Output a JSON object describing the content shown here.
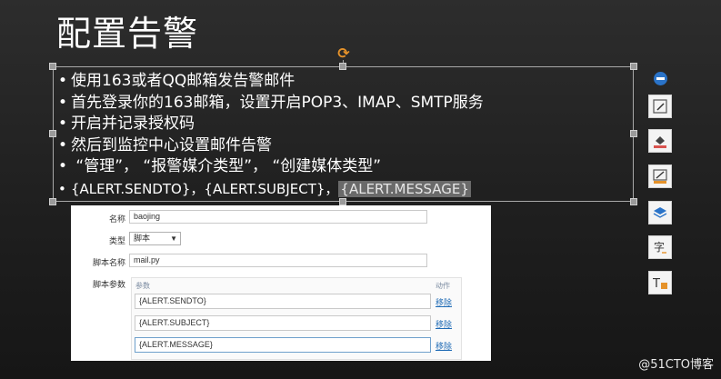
{
  "slide": {
    "title": "配置告警",
    "bullets": [
      "使用163或者QQ邮箱发告警邮件",
      "首先登录你的163邮箱，设置开启POP3、IMAP、SMTP服务",
      "开启并记录授权码",
      "然后到监控中心设置邮件告警",
      " “管理”， “报警媒介类型”， “创建媒体类型”"
    ],
    "last_bullet": {
      "part1": "{ALERT.SENDTO}，{ALERT.SUBJECT}，",
      "highlighted": "{ALERT.MESSAGE}"
    }
  },
  "form": {
    "name_label": "名称",
    "name_value": "baojing",
    "type_label": "类型",
    "type_value": "脚本",
    "script_label": "脚本名称",
    "script_value": "mail.py",
    "params_label": "脚本参数",
    "col_param": "参数",
    "col_action": "动作",
    "params": [
      {
        "value": "{ALERT.SENDTO}",
        "action": "移除"
      },
      {
        "value": "{ALERT.SUBJECT}",
        "action": "移除"
      },
      {
        "value": "{ALERT.MESSAGE}",
        "action": "移除"
      }
    ]
  },
  "toolbar": {
    "icons": [
      "collapse-icon",
      "edit-shape-icon",
      "fill-color-icon",
      "line-color-icon",
      "layers-icon",
      "text-options-icon",
      "text-resize-icon"
    ],
    "accent": "#2a73c8",
    "fill_accent": "#d9534f",
    "line_accent": "#e5922a"
  },
  "watermark": "@51CTO博客"
}
